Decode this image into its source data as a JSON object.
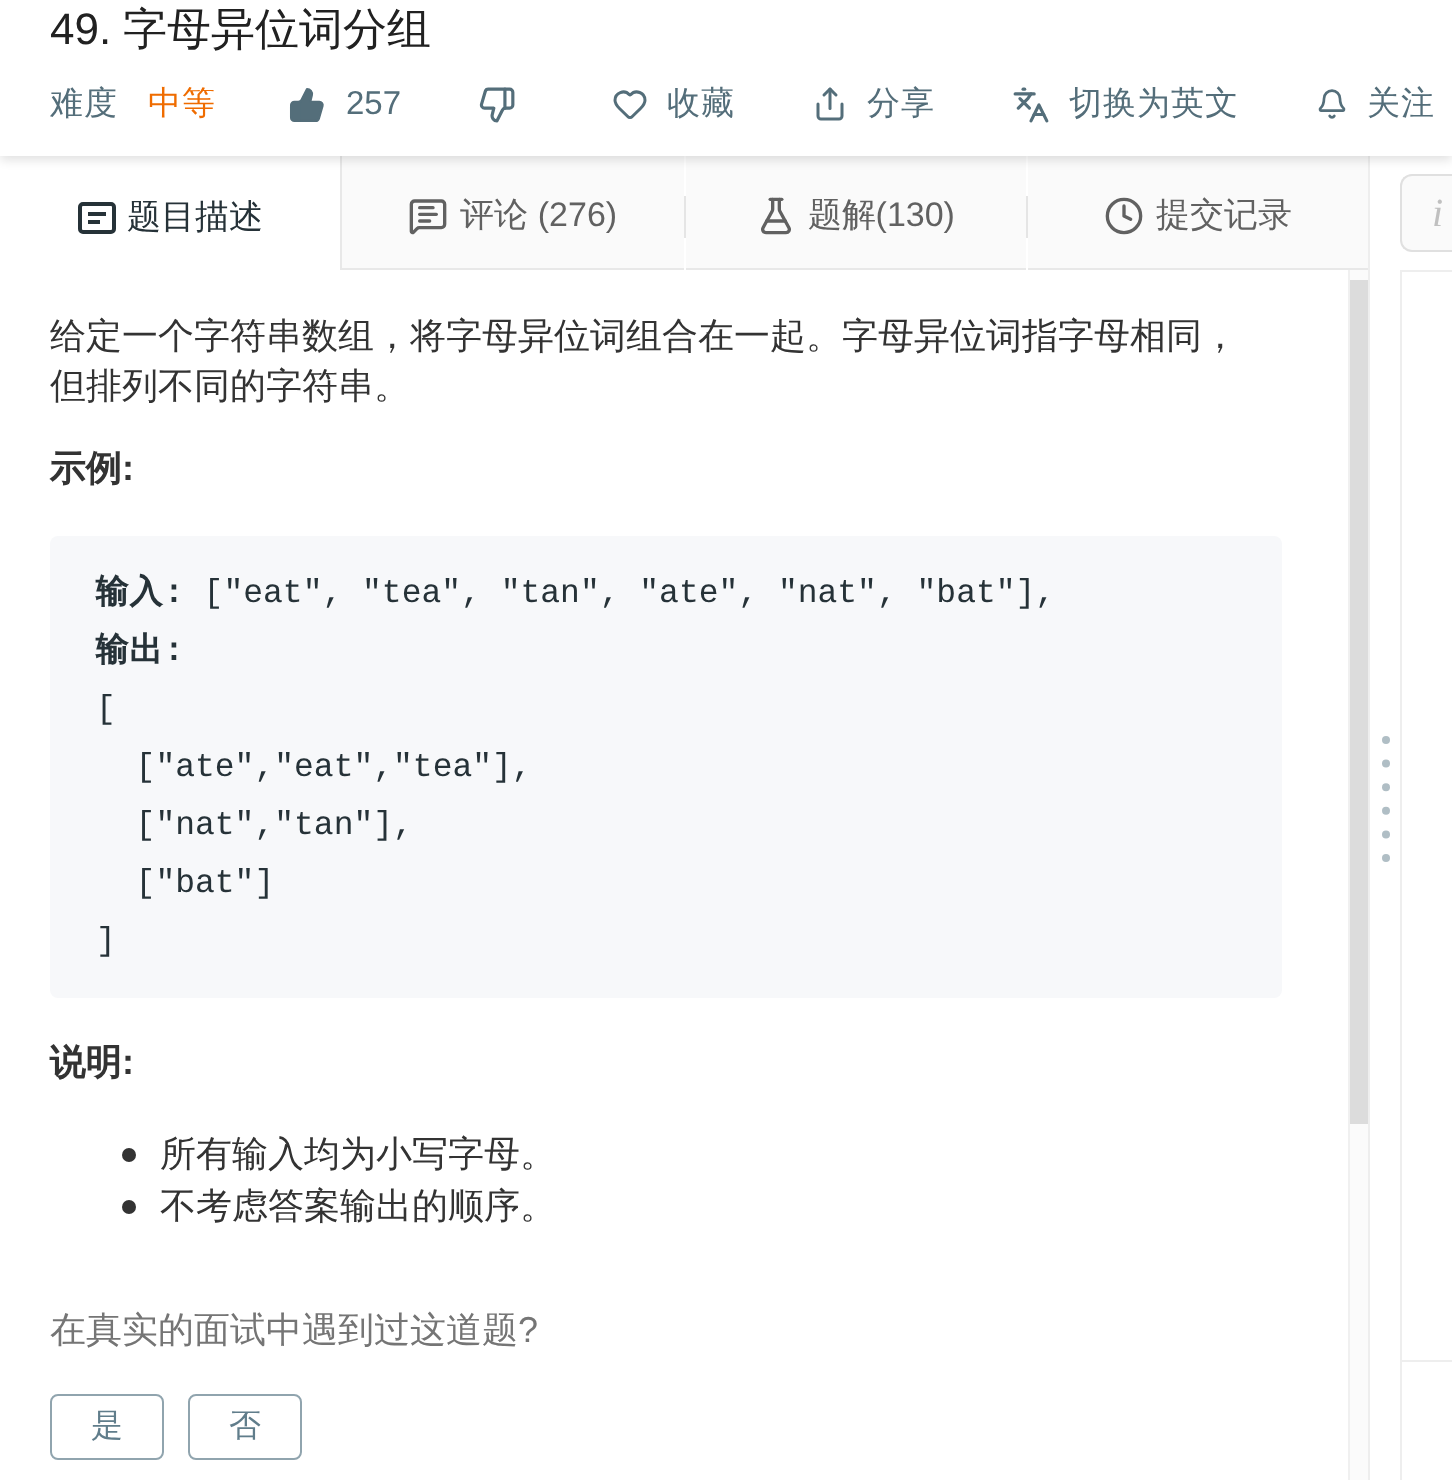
{
  "problem": {
    "title": "49. 字母异位词分组",
    "difficulty_label": "难度",
    "difficulty": "中等",
    "likes": "257",
    "actions": [
      "收藏",
      "分享",
      "切换为英文",
      "关注"
    ]
  },
  "tabs": [
    {
      "label": "题目描述",
      "selected": true
    },
    {
      "label": "评论 (276)",
      "selected": false
    },
    {
      "label": "题解(130)",
      "selected": false
    },
    {
      "label": "提交记录",
      "selected": false
    }
  ],
  "side_tab": {
    "label": "i"
  },
  "description": {
    "paragraph": "给定一个字符串数组，将字母异位词组合在一起。字母异位词指字母相同，但排列不同的字符串。",
    "example_heading": "示例:",
    "code_lines": [
      "**输入:** [\"eat\", \"tea\", \"tan\", \"ate\", \"nat\", \"bat\"],",
      "**输出:**",
      "[",
      "  [\"ate\",\"eat\",\"tea\"],",
      "  [\"nat\",\"tan\"],",
      "  [\"bat\"]",
      "]"
    ],
    "notes_heading": "说明:",
    "notes": [
      "所有输入均为小写字母。",
      "不考虑答案输出的顺序。"
    ]
  },
  "interview": {
    "question": "在真实的面试中遇到过这道题?",
    "buttons": [
      "是",
      "否"
    ]
  }
}
